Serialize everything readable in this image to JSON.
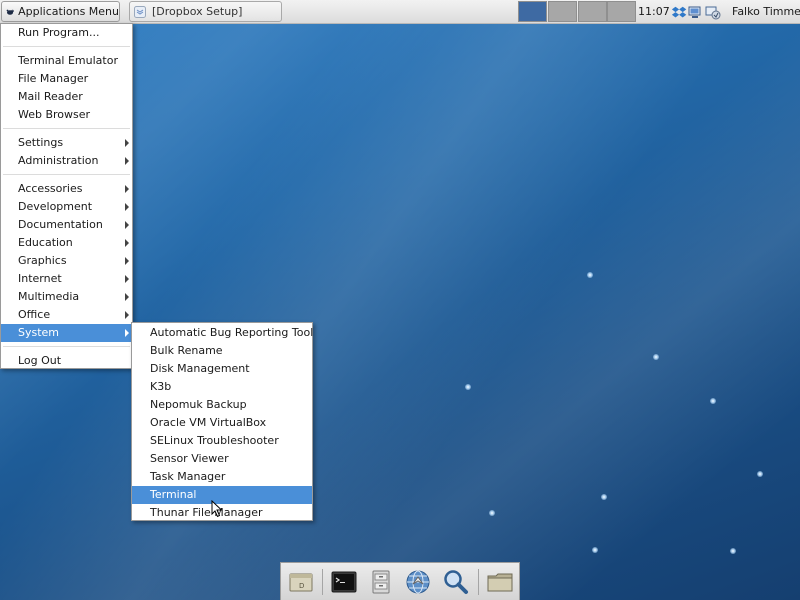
{
  "panel": {
    "apps_menu_label": "Applications Menu",
    "task_title": "[Dropbox Setup]",
    "clock": "11:07",
    "user": "Falko Timme"
  },
  "app_menu": {
    "items": [
      {
        "label": "Run Program..."
      },
      {
        "label": "Terminal Emulator"
      },
      {
        "label": "File Manager"
      },
      {
        "label": "Mail Reader"
      },
      {
        "label": "Web Browser"
      },
      {
        "label": "Settings"
      },
      {
        "label": "Administration"
      },
      {
        "label": "Accessories"
      },
      {
        "label": "Development"
      },
      {
        "label": "Documentation"
      },
      {
        "label": "Education"
      },
      {
        "label": "Graphics"
      },
      {
        "label": "Internet"
      },
      {
        "label": "Multimedia"
      },
      {
        "label": "Office"
      },
      {
        "label": "System"
      },
      {
        "label": "Log Out"
      }
    ]
  },
  "system_menu": {
    "items": [
      {
        "label": "Automatic Bug Reporting Tool"
      },
      {
        "label": "Bulk Rename"
      },
      {
        "label": "Disk Management"
      },
      {
        "label": "K3b"
      },
      {
        "label": "Nepomuk Backup"
      },
      {
        "label": "Oracle VM VirtualBox"
      },
      {
        "label": "SELinux Troubleshooter"
      },
      {
        "label": "Sensor Viewer"
      },
      {
        "label": "Task Manager"
      },
      {
        "label": "Terminal"
      },
      {
        "label": "Thunar File Manager"
      }
    ]
  },
  "colors": {
    "highlight": "#4a8fd8",
    "workspace_active": "#3e6aa3",
    "workspace_inactive": "#a7a7a7"
  }
}
